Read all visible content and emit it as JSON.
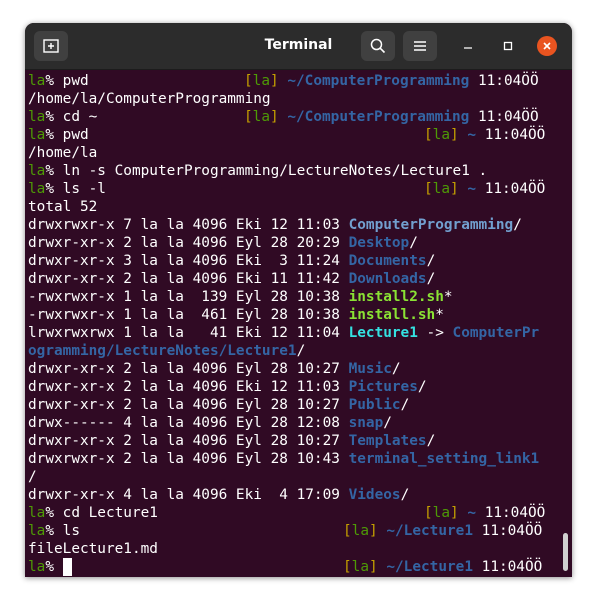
{
  "window": {
    "title": "Terminal",
    "icons": [
      "new-tab-icon",
      "search-icon",
      "menu-icon",
      "minimize-icon",
      "maximize-icon",
      "close-icon"
    ]
  },
  "colors": {
    "background": "#300a24",
    "titlebar": "#2c2c2c",
    "prompt_green": "#4e9a06",
    "bracket_yellow": "#c4a000",
    "path_blue": "#3465a4",
    "exec_green": "#8ae234",
    "link_cyan": "#34e2e2",
    "close_orange": "#e95420"
  },
  "terminal": {
    "prompt_user": "la",
    "prompt_symbol": "% ",
    "time": "11:04ÖÖ",
    "line1": {
      "cmd": "pwd",
      "path": "~/ComputerProgramming"
    },
    "line2": {
      "out": "/home/la/ComputerProgramming"
    },
    "line3": {
      "cmd": "cd ~",
      "path": "~/ComputerProgramming"
    },
    "line4": {
      "cmd": "pwd",
      "path": "~"
    },
    "line5": {
      "out": "/home/la"
    },
    "line6": {
      "cmd": "ln -s ComputerProgramming/LectureNotes/Lecture1 ."
    },
    "line7": {
      "cmd": "ls -l",
      "path": "~"
    },
    "line8": {
      "out": "total 52"
    },
    "ls": [
      {
        "meta": "drwxrwxr-x 7 la la 4096 Eki 12 11:03 ",
        "name": "ComputerProgramming",
        "suffix": "/"
      },
      {
        "meta": "drwxr-xr-x 2 la la 4096 Eyl 28 20:29 ",
        "name": "Desktop",
        "suffix": "/"
      },
      {
        "meta": "drwxr-xr-x 3 la la 4096 Eki  3 11:24 ",
        "name": "Documents",
        "suffix": "/"
      },
      {
        "meta": "drwxr-xr-x 2 la la 4096 Eki 11 11:42 ",
        "name": "Downloads",
        "suffix": "/"
      },
      {
        "meta": "-rwxrwxr-x 1 la la  139 Eyl 28 10:38 ",
        "name": "install2.sh",
        "suffix": "*"
      },
      {
        "meta": "-rwxrwxr-x 1 la la  461 Eyl 28 10:38 ",
        "name": "install.sh",
        "suffix": "*"
      }
    ],
    "link_line": {
      "meta": "lrwxrwxrwx 1 la la   41 Eki 12 11:04 ",
      "name": "Lecture1",
      "arrow": " -> ",
      "target_a": "ComputerPr",
      "target_b": "ogramming/LectureNotes/Lecture1",
      "suffix": "/"
    },
    "ls2": [
      {
        "meta": "drwxr-xr-x 2 la la 4096 Eyl 28 10:27 ",
        "name": "Music",
        "suffix": "/"
      },
      {
        "meta": "drwxr-xr-x 2 la la 4096 Eki 12 11:03 ",
        "name": "Pictures",
        "suffix": "/"
      },
      {
        "meta": "drwxr-xr-x 2 la la 4096 Eyl 28 10:27 ",
        "name": "Public",
        "suffix": "/"
      },
      {
        "meta": "drwx------ 4 la la 4096 Eyl 28 12:08 ",
        "name": "snap",
        "suffix": "/"
      },
      {
        "meta": "drwxr-xr-x 2 la la 4096 Eyl 28 10:27 ",
        "name": "Templates",
        "suffix": "/"
      }
    ],
    "wrap_line": {
      "meta": "drwxrwxr-x 2 la la 4096 Eyl 28 10:43 ",
      "name": "terminal_setting_link1",
      "suffix": "/"
    },
    "videos": {
      "meta": "drwxr-xr-x 4 la la 4096 Eki  4 17:09 ",
      "name": "Videos",
      "suffix": "/"
    },
    "line_cd": {
      "cmd": "cd Lecture1",
      "path": "~"
    },
    "line_ls": {
      "cmd": "ls",
      "path": "~/Lecture1"
    },
    "line_file": {
      "out": "fileLecture1.md"
    },
    "line_last": {
      "path": "~/Lecture1"
    }
  }
}
